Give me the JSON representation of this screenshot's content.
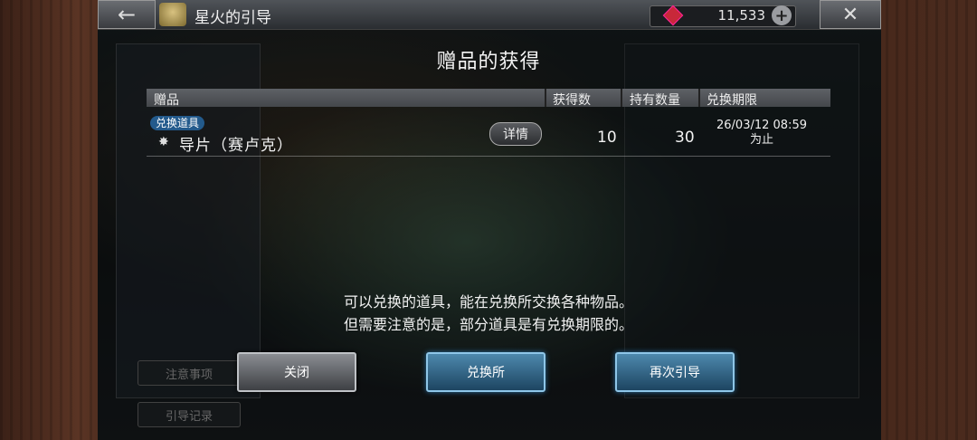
{
  "header": {
    "title": "星火的引导",
    "gem_count": "11,533",
    "back_icon": "arrow-left-icon",
    "close_icon": "close-icon",
    "add_icon": "plus-icon"
  },
  "background": {
    "notice_button": "注意事项",
    "history_button": "引导记录"
  },
  "modal": {
    "title": "赠品的获得",
    "columns": [
      "赠品",
      "获得数",
      "持有数量",
      "兑换期限"
    ],
    "rows": [
      {
        "badge": "兑换道具",
        "name": "导片（赛卢克）",
        "detail_label": "详情",
        "obtained": "10",
        "held": "30",
        "expiry_date": "26/03/12 08:59",
        "expiry_suffix": "为止"
      }
    ],
    "note_lines": [
      "可以兑换的道具，能在兑换所交换各种物品。",
      "但需要注意的是，部分道具是有兑换期限的。"
    ],
    "buttons": {
      "close": "关闭",
      "exchange": "兑换所",
      "again": "再次引导"
    }
  },
  "colors": {
    "accent_blue": "#235a8c",
    "gem_red": "#c8283a"
  }
}
